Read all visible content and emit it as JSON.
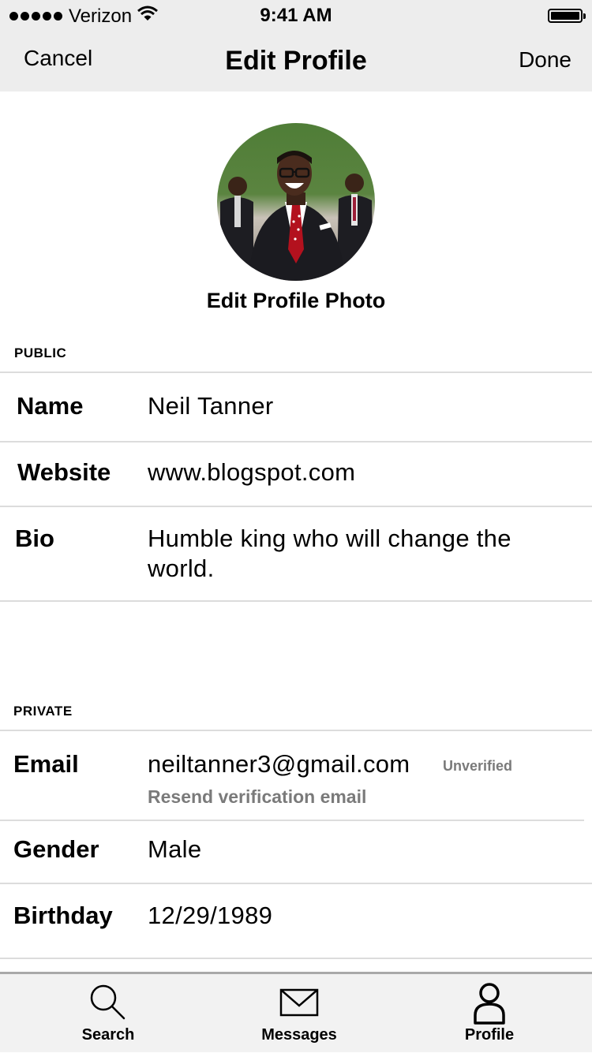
{
  "status": {
    "carrier": "Verizon",
    "time": "9:41 AM"
  },
  "nav": {
    "cancel_label": "Cancel",
    "title": "Edit Profile",
    "done_label": "Done"
  },
  "profile_photo": {
    "edit_label": "Edit Profile Photo"
  },
  "public_section": {
    "header": "PUBLIC",
    "name_label": "Name",
    "name_value": "Neil Tanner",
    "website_label": "Website",
    "website_value": "www.blogspot.com",
    "bio_label": "Bio",
    "bio_value": "Humble king who will change the world."
  },
  "private_section": {
    "header": "PRIVATE",
    "email_label": "Email",
    "email_value": "neiltanner3@gmail.com",
    "email_status": "Unverified",
    "resend_label": "Resend verification email",
    "gender_label": "Gender",
    "gender_value": "Male",
    "birthday_label": "Birthday",
    "birthday_value": "12/29/1989"
  },
  "tab_bar": {
    "search_label": "Search",
    "messages_label": "Messages",
    "profile_label": "Profile"
  },
  "icons": [
    "wifi-icon",
    "battery-icon",
    "search-icon",
    "envelope-icon",
    "person-icon"
  ]
}
